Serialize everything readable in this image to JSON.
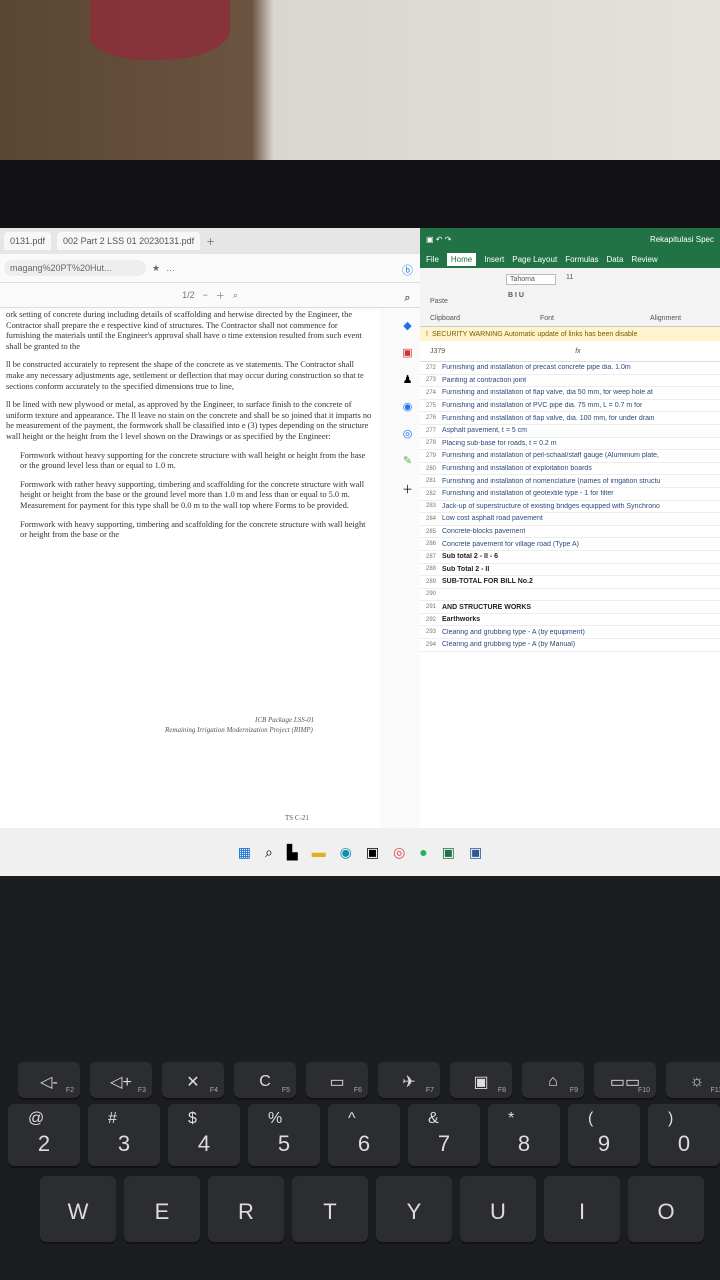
{
  "browser": {
    "tabs": [
      "0131.pdf",
      "002 Part 2 LSS 01 20230131.pdf"
    ],
    "address": "magang%20PT%20Hut...",
    "page_counter": "1/2",
    "paragraphs": [
      "ork setting of concrete during including details of scaffolding and herwise directed by the Engineer, the Contractor shall prepare the e respective kind of structures. The Contractor shall not commence for furnishing the materials until the Engineer's approval shall have o time extension resulted from such event shall be granted to the",
      "ll be constructed accurately to represent the shape of the concrete as ve statements. The Contractor shall make any necessary adjustments age, settlement or deflection that may occur during construction so that te sections conform accurately to the specified dimensions true to line,",
      "ll be lined with new plywood or metal, as approved by the Engineer, to surface finish to the concrete of uniform texture and appearance. The ll leave no stain on the concrete and shall be so joined that it imparts no he measurement of the payment, the formwork shall be classified into e (3) types depending on the structure wall height or the height from the l level shown on the Drawings or as specified by the Engineer:",
      "Formwork without heavy supporting for the concrete structure with wall height or height from the base or the ground level less than or equal to 1.0 m.",
      "Formwork with rather heavy supporting, timbering and scaffolding for the concrete structure with wall height or height from the base or the ground level more than 1.0 m and less than or equal to 5.0 m. Measurement for payment for this type shall be 0.0 m to the wall top where Forms to be provided.",
      "Formwork with heavy supporting, timbering and scaffolding for the concrete structure with wall height or height from the base or the"
    ],
    "footer_package": "ICB Package LSS-01",
    "footer_project": "Remaining Irrigation Modernization Project (RIMP)",
    "page_code": "TS C-21"
  },
  "excel": {
    "title": "Rekapitulasi Spec",
    "tabs": [
      "File",
      "Home",
      "Insert",
      "Page Layout",
      "Formulas",
      "Data",
      "Review"
    ],
    "font_name": "Tahoma",
    "font_size": "11",
    "paste_label": "Paste",
    "clipboard_label": "Clipboard",
    "font_label": "Font",
    "alignment_label": "Alignment",
    "warning": "SECURITY WARNING  Automatic update of links has been disable",
    "cell_ref": "J379",
    "fx": "fx",
    "rows": [
      {
        "n": "272",
        "t": "Furnishing and installation of precast concrete pipe dia. 1.0m",
        "b": false
      },
      {
        "n": "273",
        "t": "Painting at contraction joint",
        "b": false
      },
      {
        "n": "274",
        "t": "Furnishing and installation of flap valve, dia 50 mm, for weep hole at",
        "b": false
      },
      {
        "n": "275",
        "t": "Furnishing and installation of PVC pipe dia. 75 mm, L = 0.7 m for",
        "b": false
      },
      {
        "n": "276",
        "t": "Furnishing and installation of flap valve, dia. 100 mm, for under drain",
        "b": false
      },
      {
        "n": "277",
        "t": "Asphalt pavement, t = 5 cm",
        "b": false
      },
      {
        "n": "278",
        "t": "Placing sub-base for roads, t = 0.2 m",
        "b": false
      },
      {
        "n": "279",
        "t": "Furnishing and installation of peil-schaal/staff gauge (Aluminium plate,",
        "b": false
      },
      {
        "n": "280",
        "t": "Furnishing and installation of exploitation boards",
        "b": false
      },
      {
        "n": "281",
        "t": "Furnishing and installation of nomenclature (names of irrigation structu",
        "b": false
      },
      {
        "n": "282",
        "t": "Furnishing and installation of geotextile type - 1 for filter",
        "b": false
      },
      {
        "n": "283",
        "t": "Jack-up of superstructure of existing bridges equipped with Synchrono",
        "b": false
      },
      {
        "n": "284",
        "t": "Low cost asphalt road pavement",
        "b": false
      },
      {
        "n": "285",
        "t": "Concrete-blocks pavement",
        "b": false
      },
      {
        "n": "286",
        "t": "Concrete pavement for village road (Type A)",
        "b": false
      },
      {
        "n": "287",
        "t": "Sub total 2 - II - 6",
        "b": true
      },
      {
        "n": "288",
        "t": "Sub Total 2 - II",
        "b": true
      },
      {
        "n": "289",
        "t": "SUB-TOTAL FOR BILL No.2",
        "b": true
      },
      {
        "n": "290",
        "t": "",
        "b": false
      },
      {
        "n": "291",
        "t": "AND STRUCTURE WORKS",
        "b": true
      },
      {
        "n": "292",
        "t": "Earthworks",
        "b": true
      },
      {
        "n": "293",
        "t": "Clearing and grubbing type - A (by equipment)",
        "b": false
      },
      {
        "n": "294",
        "t": "Clearing and grubbing type - A (by Manual)",
        "b": false
      }
    ]
  },
  "keyboard": {
    "fkeys": [
      {
        "f": "F2",
        "g": "◁-"
      },
      {
        "f": "F3",
        "g": "◁+"
      },
      {
        "f": "F4",
        "g": "✕"
      },
      {
        "f": "F5",
        "g": "C"
      },
      {
        "f": "F6",
        "g": "▭"
      },
      {
        "f": "F7",
        "g": "✈"
      },
      {
        "f": "F8",
        "g": "▣"
      },
      {
        "f": "F9",
        "g": "⌂"
      },
      {
        "f": "F10",
        "g": "▭▭"
      },
      {
        "f": "F11",
        "g": "☼"
      }
    ],
    "numbers": [
      {
        "s": "@",
        "m": "2"
      },
      {
        "s": "#",
        "m": "3"
      },
      {
        "s": "$",
        "m": "4"
      },
      {
        "s": "%",
        "m": "5"
      },
      {
        "s": "^",
        "m": "6"
      },
      {
        "s": "&",
        "m": "7"
      },
      {
        "s": "*",
        "m": "8"
      },
      {
        "s": "(",
        "m": "9"
      },
      {
        "s": ")",
        "m": "0"
      }
    ],
    "letters": [
      "W",
      "E",
      "R",
      "T",
      "Y",
      "U",
      "I",
      "O"
    ]
  }
}
